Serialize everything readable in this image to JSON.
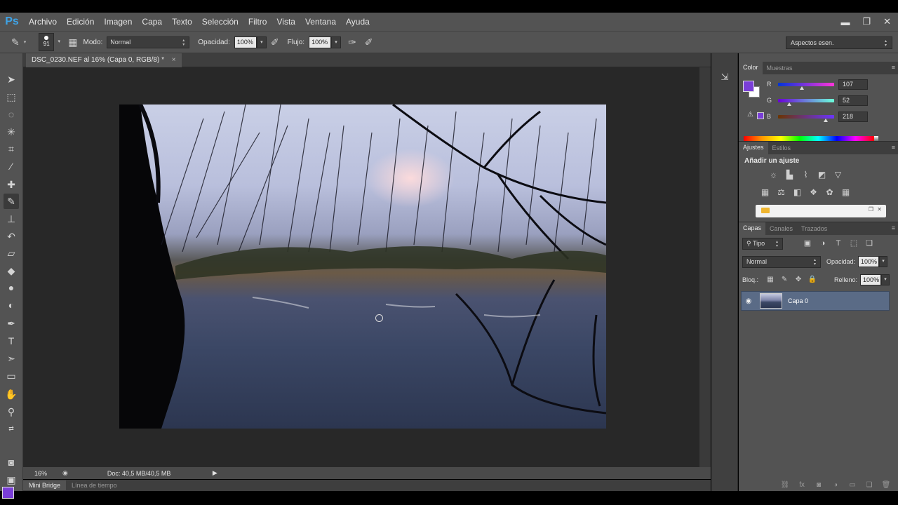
{
  "app": {
    "logo": "Ps",
    "menu": [
      "Archivo",
      "Edición",
      "Imagen",
      "Capa",
      "Texto",
      "Selección",
      "Filtro",
      "Vista",
      "Ventana",
      "Ayuda"
    ],
    "window_controls": {
      "minimize": "▬",
      "restore": "❐",
      "close": "✕"
    }
  },
  "options": {
    "brush_size": "91",
    "mode_label": "Modo:",
    "mode_value": "Normal",
    "opacity_label": "Opacidad:",
    "opacity_value": "100%",
    "flow_label": "Flujo:",
    "flow_value": "100%",
    "workspace": "Aspectos esen."
  },
  "document": {
    "tab_title": "DSC_0230.NEF al 16% (Capa 0, RGB/8) *",
    "close": "×"
  },
  "status": {
    "zoom": "16%",
    "doc_info": "Doc: 40,5 MB/40,5 MB",
    "arrow": "▶"
  },
  "bottom_tabs": [
    "Mini Bridge",
    "Línea de tiempo"
  ],
  "color_panel": {
    "tabs": [
      "Color",
      "Muestras"
    ],
    "fg": "#7a3ed8",
    "bg": "#ffffff",
    "channels": [
      {
        "label": "R",
        "value": "107",
        "level": 107
      },
      {
        "label": "G",
        "value": "52",
        "level": 52
      },
      {
        "label": "B",
        "value": "218",
        "level": 218
      }
    ]
  },
  "adjust_panel": {
    "tabs": [
      "Ajustes",
      "Estilos"
    ],
    "title": "Añadir un ajuste",
    "row1_icons": [
      "brightness-icon",
      "levels-icon",
      "curves-icon",
      "exposure-icon",
      "vibrance-icon"
    ],
    "row2_icons": [
      "hue-icon",
      "balance-icon",
      "bw-icon",
      "photo-filter-icon",
      "channel-mixer-icon",
      "lookup-icon"
    ]
  },
  "layers_panel": {
    "tabs": [
      "Capas",
      "Canales",
      "Trazados"
    ],
    "filter_kind": "Tipo",
    "blend_mode": "Normal",
    "opacity_label": "Opacidad:",
    "opacity_value": "100%",
    "lock_label": "Bloq.:",
    "fill_label": "Relleno:",
    "fill_value": "100%",
    "layers": [
      {
        "name": "Capa 0",
        "visible": true
      }
    ]
  }
}
